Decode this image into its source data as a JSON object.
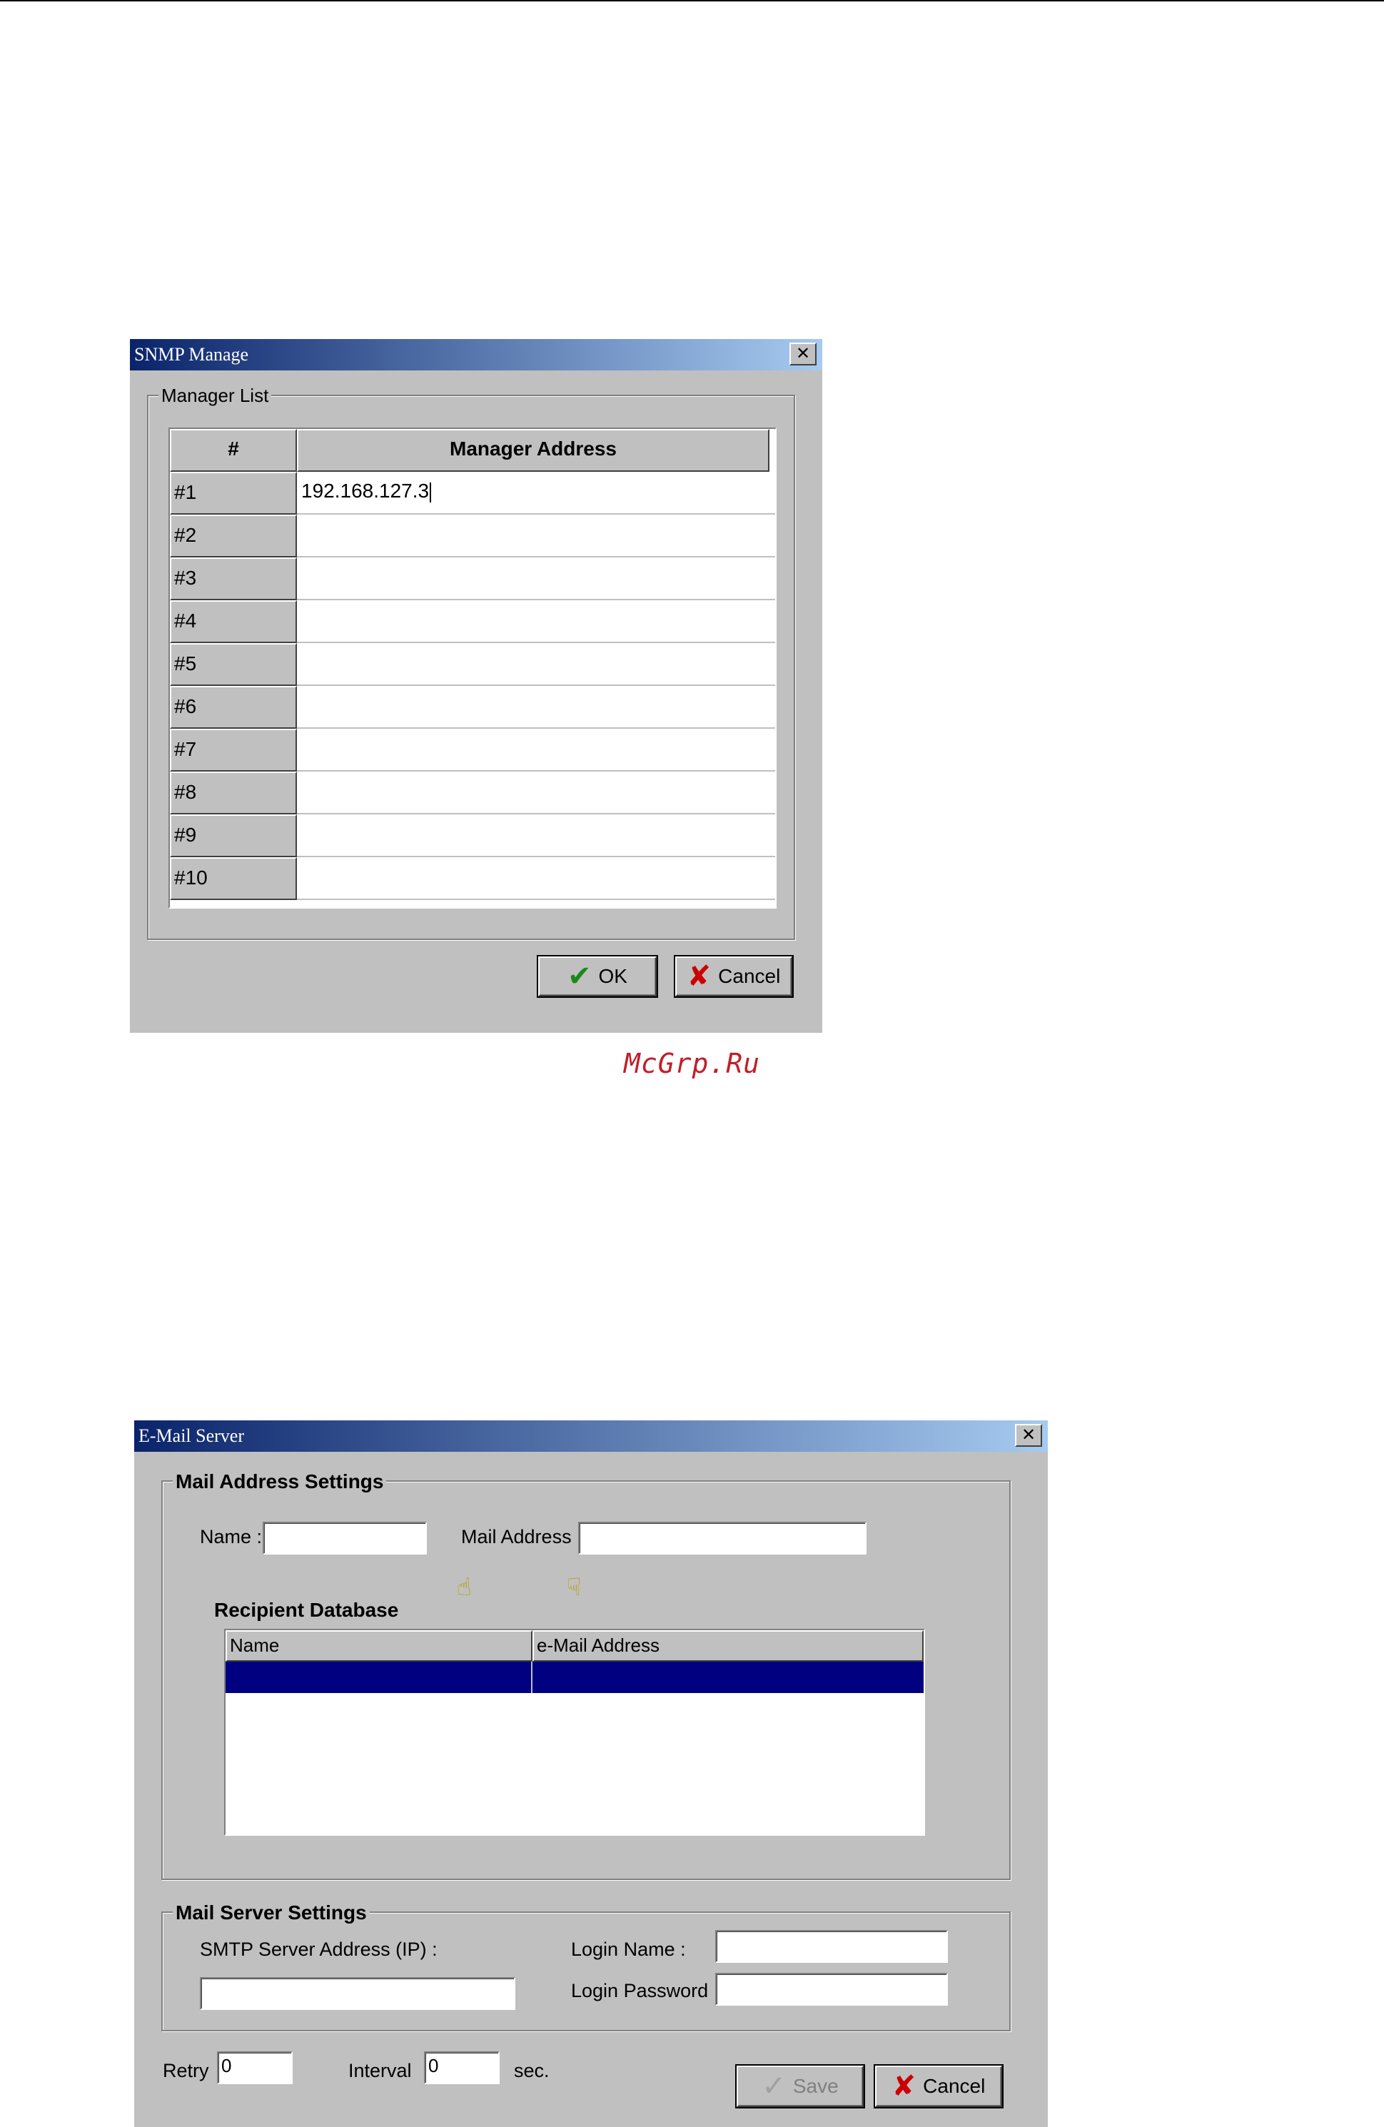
{
  "snmp_dialog": {
    "title": "SNMP Manage",
    "close_glyph": "✕",
    "group_label": "Manager List",
    "columns": [
      "#",
      "Manager Address"
    ],
    "rows": [
      {
        "num": "#1",
        "address": "192.168.127.3"
      },
      {
        "num": "#2",
        "address": ""
      },
      {
        "num": "#3",
        "address": ""
      },
      {
        "num": "#4",
        "address": ""
      },
      {
        "num": "#5",
        "address": ""
      },
      {
        "num": "#6",
        "address": ""
      },
      {
        "num": "#7",
        "address": ""
      },
      {
        "num": "#8",
        "address": ""
      },
      {
        "num": "#9",
        "address": ""
      },
      {
        "num": "#10",
        "address": ""
      }
    ],
    "ok_label": "OK",
    "cancel_label": "Cancel"
  },
  "watermark": "McGrp.Ru",
  "email_dialog": {
    "title": "E-Mail Server",
    "close_glyph": "✕",
    "mail_address_group": "Mail Address Settings",
    "name_label": "Name :",
    "name_value": "",
    "mail_address_label": "Mail Address :",
    "mail_address_value": "",
    "recipient_label": "Recipient Database",
    "list_columns": [
      "Name",
      "e-Mail Address"
    ],
    "server_group": "Mail Server Settings",
    "smtp_label": "SMTP Server Address (IP) :",
    "smtp_value": "",
    "login_name_label": "Login Name :",
    "login_name_value": "",
    "login_password_label": "Login Password :",
    "login_password_value": "",
    "retry_label": "Retry",
    "retry_value": "0",
    "interval_label": "Interval",
    "interval_value": "0",
    "sec_label": "sec.",
    "save_label": "Save",
    "cancel_label": "Cancel"
  }
}
